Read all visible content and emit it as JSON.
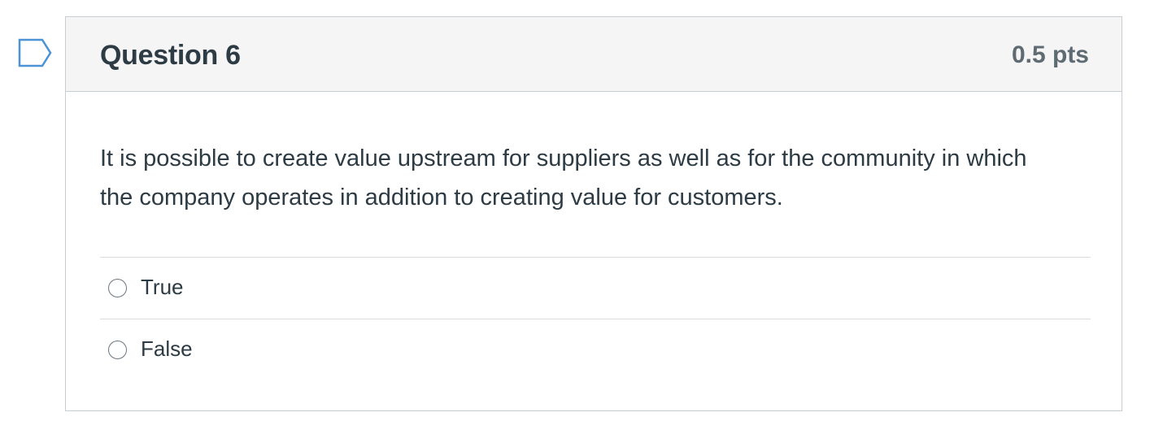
{
  "question": {
    "title": "Question 6",
    "points": "0.5 pts",
    "text": "It is possible to create value upstream for suppliers as well as for the community in which the company operates in addition to creating value for customers."
  },
  "answers": [
    {
      "label": "True"
    },
    {
      "label": "False"
    }
  ],
  "colors": {
    "flag_icon": "#4a93d4",
    "header_bg": "#f5f5f5",
    "border": "#c7cdd1",
    "text": "#2d3b45",
    "points_text": "#5f6b72"
  },
  "icons": {
    "flag": "bookmark-flag-icon",
    "radio": "radio-button"
  }
}
